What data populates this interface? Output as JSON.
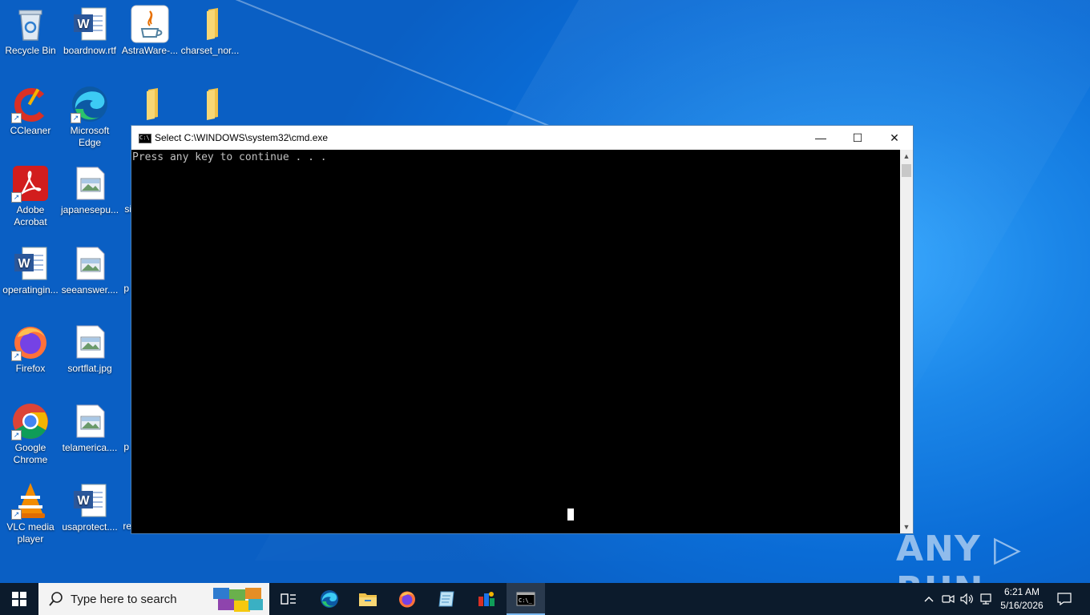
{
  "desktop": {
    "icons": [
      {
        "label": "Recycle Bin"
      },
      {
        "label": "boardnow.rtf"
      },
      {
        "label": "AstraWare-..."
      },
      {
        "label": "charset_nor..."
      },
      {
        "label": "CCleaner"
      },
      {
        "label": "Microsoft Edge"
      },
      {
        "label": ""
      },
      {
        "label": ""
      },
      {
        "label": "Adobe Acrobat"
      },
      {
        "label": "japanesepu..."
      },
      {
        "label": "si"
      },
      {
        "label": "operatingin..."
      },
      {
        "label": "seeanswer...."
      },
      {
        "label": "p"
      },
      {
        "label": "Firefox"
      },
      {
        "label": "sortflat.jpg"
      },
      {
        "label": "Google Chrome"
      },
      {
        "label": "telamerica...."
      },
      {
        "label": "p"
      },
      {
        "label": "VLC media player"
      },
      {
        "label": "usaprotect...."
      },
      {
        "label": "re"
      }
    ]
  },
  "cmd_window": {
    "title": "Select C:\\WINDOWS\\system32\\cmd.exe",
    "output": "Press any key to continue . . .",
    "minimize_glyph": "—",
    "maximize_glyph": "☐",
    "close_glyph": "✕"
  },
  "watermark": {
    "text": "ANY ▷ RUN"
  },
  "taskbar": {
    "search_placeholder": "Type here to search",
    "clock_time": "6:21 AM",
    "clock_date": "5/16/2026"
  },
  "colors": {
    "desktop_blue": "#0a6cd6",
    "taskbar": "#0c1b2c",
    "titlebar": "#ffffff"
  }
}
